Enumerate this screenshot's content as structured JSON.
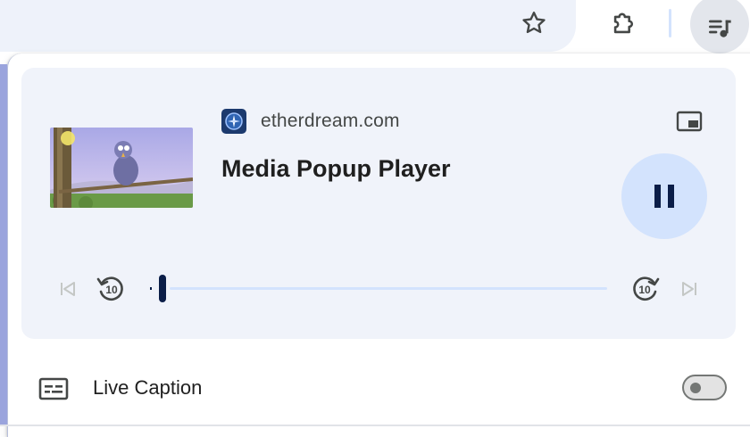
{
  "toolbar": {
    "bookmark_icon": "star-outline-icon",
    "extensions_icon": "puzzle-piece-icon",
    "media_controls_icon": "queue-music-icon"
  },
  "media_player": {
    "source": "etherdream.com",
    "title": "Media Popup Player",
    "favicon_icon": "compass-badge-icon",
    "pip_icon": "picture-in-picture-icon",
    "play_state": "playing",
    "play_pause_icon": "pause-icon",
    "previous_track_icon": "skip-previous-icon",
    "replay_label": "10",
    "replay_icon": "replay-10-icon",
    "forward_label": "10",
    "forward_icon": "forward-10-icon",
    "next_track_icon": "skip-next-icon",
    "progress_fraction": 0.02
  },
  "live_caption": {
    "label": "Live Caption",
    "icon": "closed-caption-icon",
    "enabled": false
  },
  "colors": {
    "card_bg": "#f0f3fa",
    "accent_light": "#d3e3fd",
    "accent_dark": "#0b1e48",
    "text_primary": "#1f1f1f",
    "text_secondary": "#444746"
  }
}
